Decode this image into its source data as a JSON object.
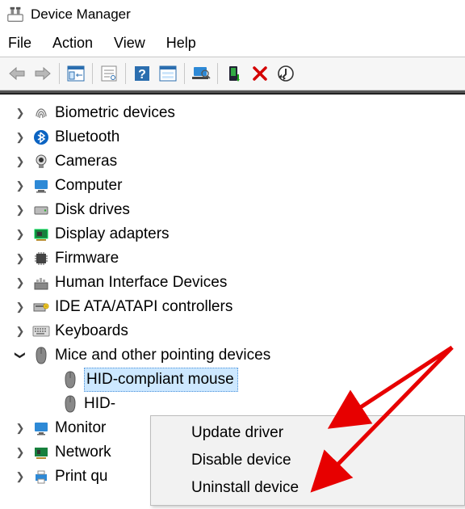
{
  "window": {
    "title": "Device Manager"
  },
  "menubar": {
    "file": "File",
    "action": "Action",
    "view": "View",
    "help": "Help"
  },
  "tree": {
    "items": [
      {
        "label": "Biometric devices",
        "icon": "fingerprint"
      },
      {
        "label": "Bluetooth",
        "icon": "bluetooth"
      },
      {
        "label": "Cameras",
        "icon": "camera"
      },
      {
        "label": "Computer",
        "icon": "computer"
      },
      {
        "label": "Disk drives",
        "icon": "disk"
      },
      {
        "label": "Display adapters",
        "icon": "display-adapter"
      },
      {
        "label": "Firmware",
        "icon": "firmware"
      },
      {
        "label": "Human Interface Devices",
        "icon": "hid"
      },
      {
        "label": "IDE ATA/ATAPI controllers",
        "icon": "ide"
      },
      {
        "label": "Keyboards",
        "icon": "keyboard"
      },
      {
        "label": "Mice and other pointing devices",
        "icon": "mouse",
        "expanded": true,
        "children": [
          {
            "label": "HID-compliant mouse",
            "icon": "mouse",
            "selected": true
          },
          {
            "label": "HID-",
            "icon": "mouse",
            "truncated": true
          }
        ]
      },
      {
        "label": "Monitor",
        "icon": "monitor",
        "truncated": true
      },
      {
        "label": "Network",
        "icon": "network",
        "truncated": true
      },
      {
        "label": "Print qu",
        "icon": "printer",
        "truncated": true
      }
    ]
  },
  "context_menu": {
    "items": [
      {
        "label": "Update driver"
      },
      {
        "label": "Disable device"
      },
      {
        "label": "Uninstall device"
      }
    ]
  }
}
